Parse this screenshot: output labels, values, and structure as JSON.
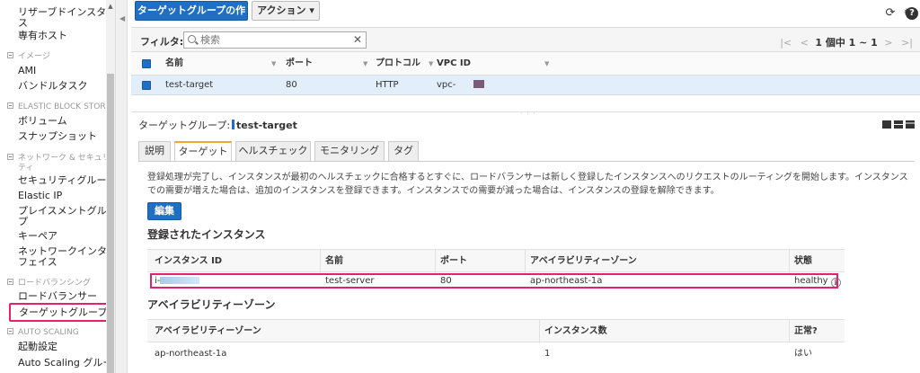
{
  "sidebar": {
    "items": [
      {
        "label": "リザーブドインスタン",
        "type": "item"
      },
      {
        "label": "ス",
        "type": "item"
      },
      {
        "label": "専有ホスト",
        "type": "item"
      },
      {
        "label": "イメージ",
        "type": "header"
      },
      {
        "label": "AMI",
        "type": "item"
      },
      {
        "label": "バンドルタスク",
        "type": "item"
      },
      {
        "label": "ELASTIC BLOCK STORE",
        "type": "header"
      },
      {
        "label": "ボリューム",
        "type": "item"
      },
      {
        "label": "スナップショット",
        "type": "item"
      },
      {
        "label": "ネットワーク & セキュリ",
        "type": "header"
      },
      {
        "label": "ティ",
        "type": "header"
      },
      {
        "label": "セキュリティグループ",
        "type": "item"
      },
      {
        "label": "Elastic IP",
        "type": "item"
      },
      {
        "label": "プレイスメントグルー",
        "type": "item"
      },
      {
        "label": "プ",
        "type": "item"
      },
      {
        "label": "キーペア",
        "type": "item"
      },
      {
        "label": "ネットワークインター",
        "type": "item"
      },
      {
        "label": "フェイス",
        "type": "item"
      },
      {
        "label": "ロードバランシング",
        "type": "header"
      },
      {
        "label": "ロードバランサー",
        "type": "item"
      },
      {
        "label": "ターゲットグループ",
        "type": "active"
      },
      {
        "label": "AUTO SCALING",
        "type": "header"
      },
      {
        "label": "起動設定",
        "type": "item"
      },
      {
        "label": "Auto Scaling グループ",
        "type": "item"
      }
    ]
  },
  "toolbar": {
    "create_label": "ターゲットグループの作成",
    "action_label": "アクション ▾"
  },
  "filter": {
    "label": "フィルタ:",
    "placeholder": "検索",
    "clear": "✕",
    "pager_first": "|<",
    "pager_prev": "<",
    "pager_text": "1 個中 1 ~ 1",
    "pager_next": ">",
    "pager_last": ">|"
  },
  "target_table": {
    "columns": [
      "名前",
      "ポート",
      "プロトコル",
      "VPC ID"
    ],
    "rows": [
      {
        "name": "test-target",
        "port": "80",
        "protocol": "HTTP",
        "vpc": "vpc-"
      }
    ]
  },
  "detail": {
    "title_prefix": "ターゲットグループ:",
    "title_name": "test-target",
    "tabs": [
      "説明",
      "ターゲット",
      "ヘルスチェック",
      "モニタリング",
      "タグ"
    ],
    "description": "登録処理が完了し、インスタンスが最初のヘルスチェックに合格するとすぐに、ロードバランサーは新しく登録したインスタンスへのリクエストのルーティングを開始します。インスタンスでの需要が増えた場合は、追加のインスタンスを登録できます。インスタンスでの需要が減った場合は、インスタンスの登録を解除できます。",
    "edit_label": "編集",
    "registered_heading": "登録されたインスタンス",
    "instance_columns": [
      "インスタンス ID",
      "名前",
      "ポート",
      "アベイラビリティーゾーン",
      "状態"
    ],
    "instances": [
      {
        "id": "i-",
        "name": "test-server",
        "port": "80",
        "az": "ap-northeast-1a",
        "status": "healthy"
      }
    ],
    "az_heading": "アベイラビリティーゾーン",
    "az_columns": [
      "アベイラビリティーゾーン",
      "インスタンス数",
      "正常?"
    ],
    "az_rows": [
      {
        "az": "ap-northeast-1a",
        "count": "1",
        "healthy": "はい"
      }
    ]
  },
  "colors": {
    "accent": "#1f6fc5",
    "highlight": "#e1236f",
    "tab_active": "#f5a623",
    "row_selected": "#e2eefa"
  },
  "icons": [
    "refresh-icon",
    "gear-icon",
    "help-icon",
    "search-icon",
    "info-icon"
  ]
}
